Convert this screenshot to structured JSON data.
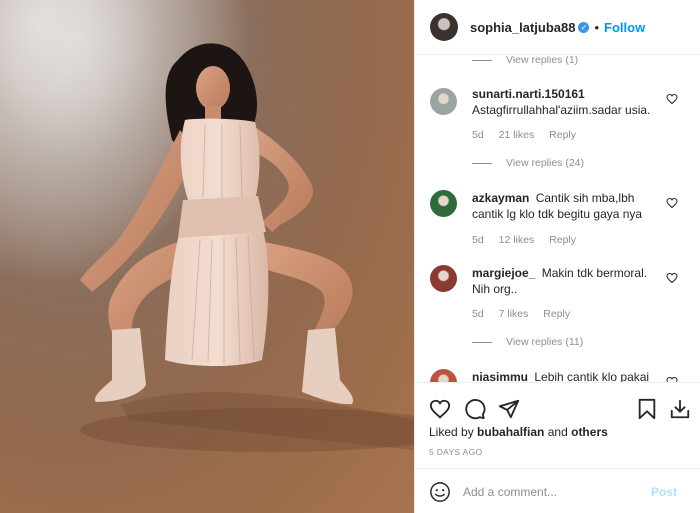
{
  "post": {
    "username": "sophia_latjuba88",
    "separator": "•",
    "follow_label": "Follow",
    "verified_glyph": "✓"
  },
  "comments": [
    {
      "kind": "replies",
      "label": "View replies (1)"
    },
    {
      "kind": "comment",
      "username": "sunarti.narti.150161",
      "text": "Astagfirrullahhal'aziim.sadar usia.",
      "age": "5d",
      "likes": "21 likes",
      "reply_label": "Reply",
      "avatar_color": "#9aa5a0"
    },
    {
      "kind": "replies",
      "label": "View replies (24)"
    },
    {
      "kind": "comment",
      "username": "azkayman",
      "text": "Cantik sih mba,lbh cantik lg klo tdk begitu gaya nya",
      "age": "5d",
      "likes": "12 likes",
      "reply_label": "Reply",
      "avatar_color": "#2f6b3a"
    },
    {
      "kind": "comment",
      "username": "margiejoe_",
      "text": "Makin tdk bermoral. Nih org..",
      "age": "5d",
      "likes": "7 likes",
      "reply_label": "Reply",
      "avatar_color": "#8a3b2f"
    },
    {
      "kind": "replies",
      "label": "View replies (11)"
    },
    {
      "kind": "comment",
      "username": "niasimmu",
      "text": "Lebih cantik klo pakai",
      "age": "",
      "likes": "",
      "reply_label": "",
      "avatar_color": "#b8553a"
    }
  ],
  "likes": {
    "prefix": "Liked by",
    "user": "bubahalfian",
    "middle": "and",
    "others": "others"
  },
  "time_ago": "5 DAYS AGO",
  "add_comment": {
    "placeholder": "Add a comment...",
    "post_label": "Post"
  },
  "colors": {
    "follow": "#0095f6",
    "post_disabled": "#b2dffc",
    "secondary_text": "#8e8e8e"
  },
  "icons": {
    "actions": [
      "heart-icon",
      "comment-icon",
      "share-icon",
      "bookmark-icon",
      "download-icon"
    ],
    "comment": "heart-outline-icon",
    "emoji": "emoji-icon"
  }
}
